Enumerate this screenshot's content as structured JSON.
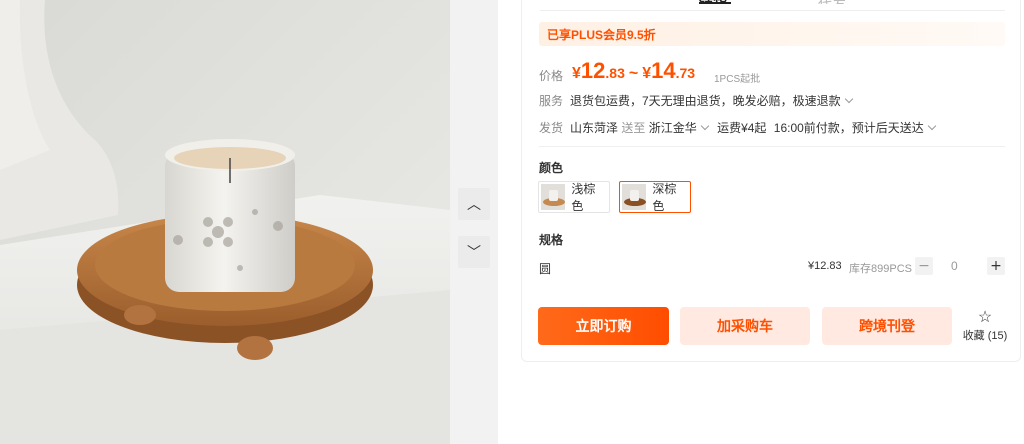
{
  "tabs": {
    "active": "铺货",
    "inactive": "代发"
  },
  "plus_banner": "已享PLUS会员9.5折",
  "price": {
    "label": "价格",
    "currency": "¥",
    "min_int": "12",
    "min_dec": ".83",
    "tilde": "~",
    "max_int": "14",
    "max_dec": ".73",
    "moq": "1PCS起批"
  },
  "service": {
    "label": "服务",
    "text": "退货包运费，7天无理由退货，晚发必赔，极速退款"
  },
  "shipping": {
    "label": "发货",
    "origin": "山东菏泽",
    "to_label": "送至",
    "destination": "浙江金华",
    "fee": "运费¥4起",
    "eta": "16:00前付款，预计后天送达"
  },
  "color": {
    "title": "颜色",
    "options": [
      {
        "label": "浅棕色",
        "selected": false
      },
      {
        "label": "深棕色",
        "selected": true
      }
    ]
  },
  "spec": {
    "title": "规格",
    "row": {
      "name": "圆",
      "price": "¥12.83",
      "stock": "库存899PCS",
      "minus": "−",
      "qty": "0",
      "plus": "+"
    }
  },
  "actions": {
    "order": "立即订购",
    "cart": "加采购车",
    "crossborder": "跨境刊登",
    "favorite_label": "收藏",
    "favorite_count": "(15)"
  },
  "nav": {
    "up": "︿",
    "down": "﹀"
  },
  "colors": {
    "accent": "#ff5000",
    "accent_light": "#ffe9e0",
    "plus_bg": "#fff0e4"
  },
  "icons": [
    "chevron-up-icon",
    "chevron-down-icon",
    "star-icon"
  ]
}
